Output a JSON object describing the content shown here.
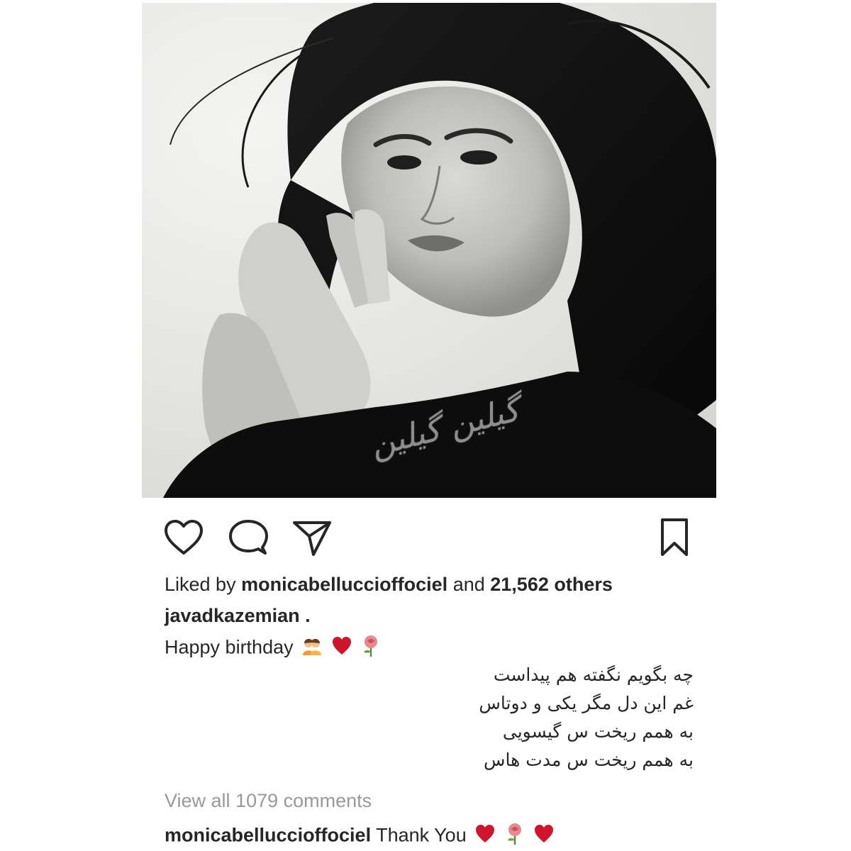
{
  "post": {
    "watermark": "گیلین گیلین",
    "likes": {
      "prefix": "Liked by",
      "user": "monicabelluccioffociel",
      "joiner": "and",
      "others": "21,562 others"
    },
    "caption_user": "javadkazemian .",
    "caption_text": "Happy birthday",
    "caption_emojis": [
      "couple-emoji",
      "heart-emoji",
      "rose-emoji"
    ],
    "poem_lines": [
      "چه بگویم نگفته هم پیداست",
      "غم این دل مگر یکی و دوتاس",
      "به همم ریخت س گیسویی",
      "به همم ریخت س مدت هاس"
    ],
    "view_comments": "View all 1079 comments",
    "comment": {
      "user": "monicabelluccioffociel",
      "text": "Thank You",
      "emojis": [
        "heart-emoji",
        "rose-emoji",
        "heart-emoji"
      ]
    }
  },
  "icons": {
    "like": "heart-outline-icon",
    "comment": "comment-bubble-icon",
    "share": "paper-plane-icon",
    "save": "bookmark-icon"
  },
  "colors": {
    "text": "#262626",
    "muted": "#999999",
    "heart": "#d0142c",
    "rose": "#e8898e"
  }
}
